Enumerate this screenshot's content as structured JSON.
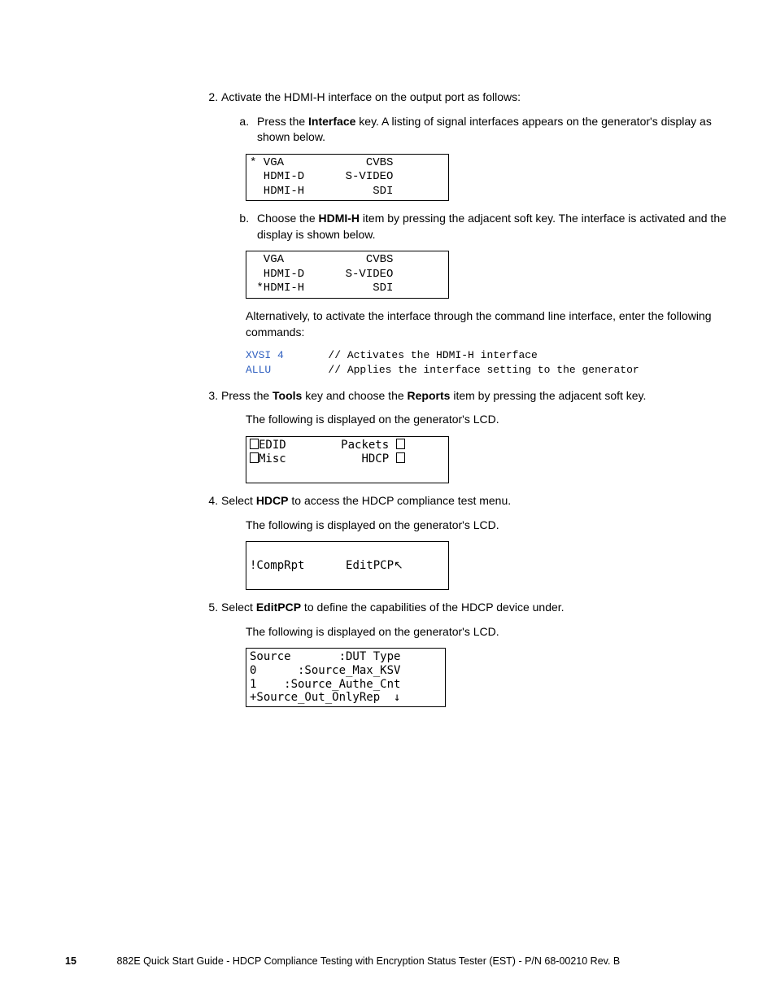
{
  "steps": {
    "s2": {
      "text": "Activate the HDMI-H interface on the output port as follows:",
      "a_pre": "Press the ",
      "a_bold": "Interface",
      "a_post": " key. A listing of signal interfaces appears on the generator's display as shown below.",
      "display1": "* VGA            CVBS\n  HDMI-D      S-VIDEO\n  HDMI-H          SDI\n",
      "b_pre": "Choose the ",
      "b_bold": "HDMI-H",
      "b_post": " item by pressing the adjacent soft key. The interface is activated and the display is shown below.",
      "display2": "  VGA            CVBS\n  HDMI-D      S-VIDEO\n *HDMI-H          SDI\n",
      "alt_text": "Alternatively, to activate the interface through the command line interface, enter the following commands:",
      "cmd1": "XVSI 4",
      "cmd1_comment": "       // Activates the HDMI-H interface",
      "cmd2": "ALLU",
      "cmd2_comment": "         // Applies the interface setting to the generator"
    },
    "s3": {
      "pre1": "Press the ",
      "bold1": "Tools",
      "mid1": " key and choose the ",
      "bold2": "Reports",
      "post1": " item by pressing the adjacent soft key.",
      "following": "The following is displayed on the generator's LCD.",
      "display_l1_left": "EDID",
      "display_l1_right": "Packets",
      "display_l2_left": "Misc",
      "display_l2_right": "HDCP"
    },
    "s4": {
      "pre": "Select ",
      "bold": "HDCP",
      "post": " to access the HDCP compliance test menu.",
      "following": "The following is displayed on the generator's LCD.",
      "display_left": "!CompRpt",
      "display_right": "EditPCP"
    },
    "s5": {
      "pre": "Select ",
      "bold": "EditPCP",
      "post": " to define the capabilities of the HDCP device under.",
      "following": "The following is displayed on the generator's LCD.",
      "display": "Source       :DUT Type\n0      :Source_Max_KSV\n1    :Source_Authe_Cnt\n+Source_Out_OnlyRep  ↓"
    }
  },
  "footer": {
    "pagenum": "15",
    "title": "882E Quick Start Guide - HDCP Compliance Testing with Encryption Status Tester (EST)    -   P/N 68-00210 Rev. B"
  }
}
